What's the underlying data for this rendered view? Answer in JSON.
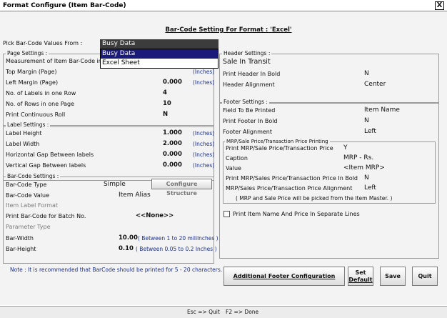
{
  "window": {
    "title": "Format Configure (Item Bar-Code)",
    "close_glyph": "X"
  },
  "header": {
    "title": "Bar-Code Setting For Format : 'Excel'"
  },
  "pick": {
    "label": "Pick Bar-Code Values From :",
    "value": "Busy Data",
    "options": [
      "Busy Data",
      "Excel Sheet"
    ]
  },
  "page_settings": {
    "legend": "Page Settings :",
    "measurement_label": "Measurement of Item Bar-Code in",
    "top_margin": {
      "label": "Top Margin (Page)",
      "unit": "(Inches)"
    },
    "left_margin": {
      "label": "Left Margin (Page)",
      "value": "0.000",
      "unit": "(Inches)"
    },
    "labels_in_row": {
      "label": "No. of Labels in one Row",
      "value": "4"
    },
    "rows_in_page": {
      "label": "No. of Rows in one Page",
      "value": "10"
    },
    "continuous_roll": {
      "label": "Print Continuous Roll",
      "value": "N"
    }
  },
  "label_settings": {
    "legend": "Label Settings :",
    "rows": [
      {
        "label": "Label Height",
        "value": "1.000",
        "unit": "(Inches)"
      },
      {
        "label": "Label Width",
        "value": "2.000",
        "unit": "(Inches)"
      },
      {
        "label": "Horizontal Gap Between labels",
        "value": "0.000",
        "unit": "(Inches)"
      },
      {
        "label": "Vertical Gap Between labels",
        "value": "0.000",
        "unit": "(Inches)"
      }
    ]
  },
  "barcode_settings": {
    "legend": "Bar-Code Settings :",
    "type": {
      "label": "Bar-Code Type",
      "value": "Simple"
    },
    "configure_button": "Configure Structure",
    "value": {
      "label": "Bar-Code Value",
      "value": "Item Alias"
    },
    "item_label_format": "Item Label Format",
    "batch": {
      "label": "Print Bar-Code for Batch No.",
      "value": "<<None>>"
    },
    "parameter_type": "Parameter Type",
    "width": {
      "label": "Bar-Width",
      "value": "10.00",
      "hint": "( Between 1 to 20 mililnches )"
    },
    "height": {
      "label": "Bar-Height",
      "value": "0.10",
      "hint": "( Between 0.05 to 0.2 Inches )"
    }
  },
  "header_settings": {
    "legend": "Header Settings :",
    "text": "Sale In Transit",
    "bold": {
      "label": "Print Header In Bold",
      "value": "N"
    },
    "alignment": {
      "label": "Header Alignment",
      "value": "Center"
    }
  },
  "footer_settings": {
    "legend": "Footer Settings :",
    "field": {
      "label": "Field To Be Printed",
      "value": "Item Name"
    },
    "bold": {
      "label": "Print Footer In Bold",
      "value": "N"
    },
    "alignment": {
      "label": "Footer Alignment",
      "value": "Left"
    }
  },
  "mrp": {
    "legend": "MRP/Sale Price/Transaction Price Printing",
    "print": {
      "label": "Print MRP/Sale Price/Transaction Price",
      "value": "Y"
    },
    "caption": {
      "label": "Caption",
      "value": "MRP - Rs."
    },
    "value": {
      "label": "Value",
      "value": "<Item MRP>"
    },
    "bold": {
      "label": "Print MRP/Sales Price/Transaction Price In Bold",
      "value": "N"
    },
    "alignment": {
      "label": "MRP/Sales Price/Transaction Price Alignment",
      "value": "Left"
    },
    "note": "( MRP and Sale Price will be picked from the Item Master. )"
  },
  "separate_lines": {
    "label": "Print Item Name And Price In Separate Lines"
  },
  "note": "Note : It is recommended that BarCode should be printed for 5 - 20 characters.",
  "buttons": {
    "additional_footer": "Additional Footer Configuration",
    "set_default_1": "Set",
    "set_default_2": "Default",
    "save": "Save",
    "quit": "Quit"
  },
  "shortcuts": {
    "esc": "Esc => Quit",
    "f2": "F2 => Done"
  },
  "colors": {
    "hint_blue": "#1a2f8a",
    "selection": "#1a1a7a",
    "background": "#f3f3f3"
  }
}
